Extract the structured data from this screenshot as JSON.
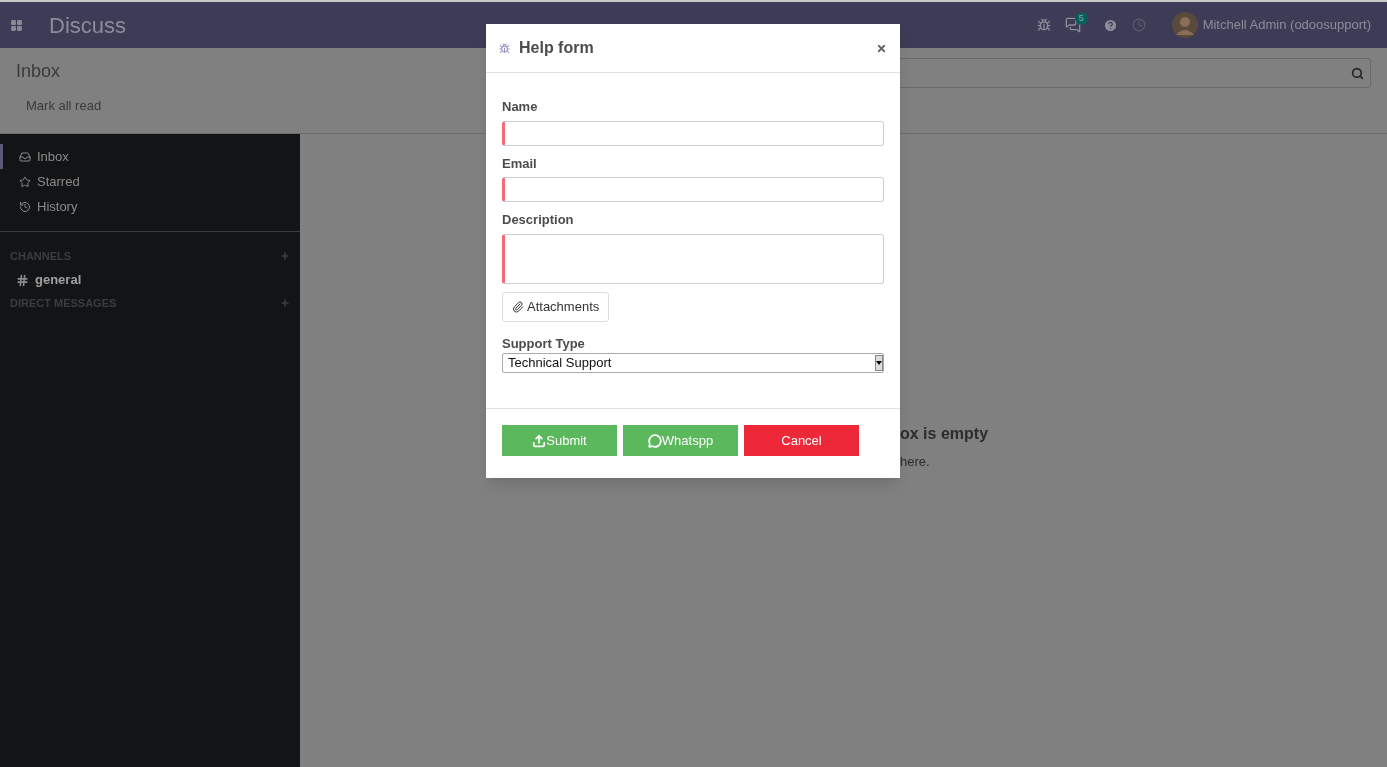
{
  "topbar": {
    "app_title": "Discuss",
    "notification_count": "5",
    "user_name": "Mitchell Admin (odoosupport)"
  },
  "control_panel": {
    "title": "Inbox",
    "button": "Mark all read"
  },
  "sidebar": {
    "items": [
      {
        "label": "Inbox",
        "selected": true
      },
      {
        "label": "Starred",
        "selected": false
      },
      {
        "label": "History",
        "selected": false
      }
    ],
    "sections": [
      {
        "heading": "CHANNELS",
        "channels": [
          "general"
        ]
      },
      {
        "heading": "DIRECT MESSAGES"
      }
    ]
  },
  "empty_state": {
    "title": "ox is empty",
    "text": "here."
  },
  "modal": {
    "title": "Help form",
    "fields": [
      {
        "label": "Name",
        "kind": "input",
        "required": true
      },
      {
        "label": "Email",
        "kind": "input",
        "required": true
      },
      {
        "label": "Description",
        "kind": "textarea",
        "required": true
      }
    ],
    "attachments_button": "Attachments",
    "support_type": {
      "label": "Support Type",
      "value": "Technical Support"
    },
    "buttons": [
      {
        "label": "Submit",
        "kind": "submit"
      },
      {
        "label": "Whatspp",
        "kind": "whatsapp"
      },
      {
        "label": "Cancel",
        "kind": "cancel"
      }
    ]
  }
}
